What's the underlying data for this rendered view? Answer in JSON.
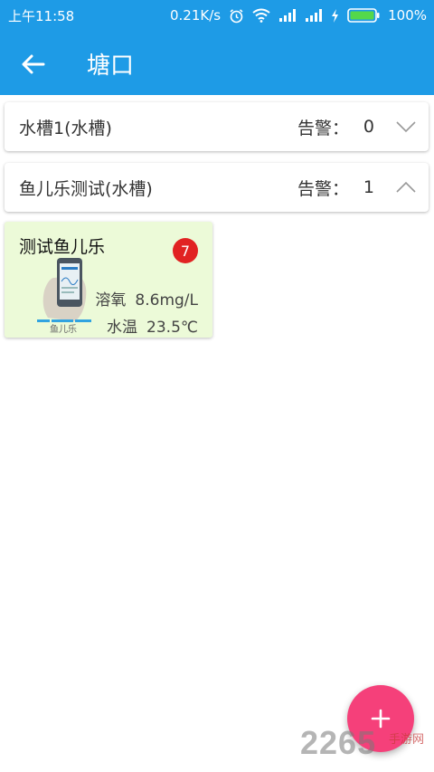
{
  "status_bar": {
    "time": "上午11:58",
    "speed": "0.21K/s",
    "battery": "100%",
    "icons": [
      "alarm-icon",
      "wifi-icon",
      "signal-icon",
      "signal-icon",
      "charging-icon",
      "battery-icon"
    ]
  },
  "app_bar": {
    "title": "塘口",
    "back_icon": "arrow-left-icon",
    "color": "#1e9be6"
  },
  "groups": [
    {
      "name": "水槽1(水槽)",
      "alarm_label": "告警：",
      "alarm_count": "0",
      "expanded": false
    },
    {
      "name": "鱼儿乐测试(水槽)",
      "alarm_label": "告警：",
      "alarm_count": "1",
      "expanded": true
    }
  ],
  "device_card": {
    "title": "测试鱼儿乐",
    "badge": "7",
    "thumbnail_caption": "鱼儿乐",
    "metrics": [
      {
        "label": "溶氧",
        "value": "8.6mg/L"
      },
      {
        "label": "水温",
        "value": "23.5℃"
      }
    ],
    "background": "#ecfad8"
  },
  "fab": {
    "icon": "plus-icon",
    "color": "#f5407a"
  },
  "watermark": {
    "text": "2265",
    "sub": "手游网"
  }
}
